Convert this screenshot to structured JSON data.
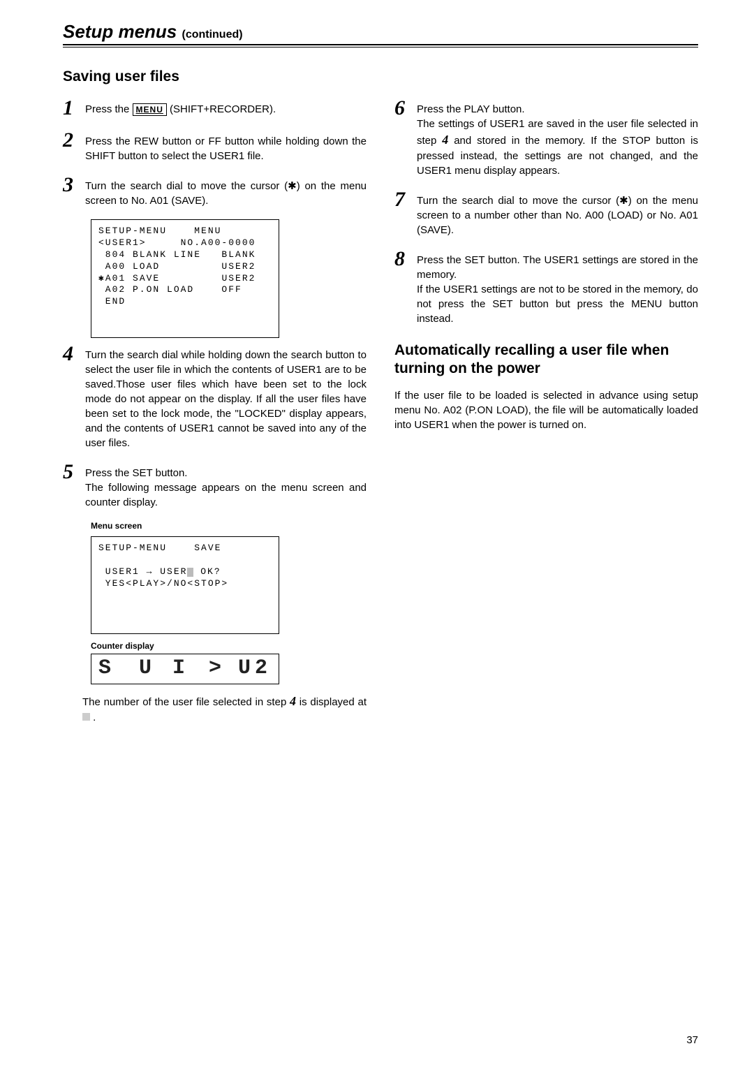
{
  "header": {
    "title": "Setup menus",
    "continued": "(continued)"
  },
  "section_title": "Saving user files",
  "steps_left": {
    "s1": {
      "num": "1",
      "pre": "Press the ",
      "menu_btn": "MENU",
      "post": " (SHIFT+RECORDER)."
    },
    "s2": {
      "num": "2",
      "text": "Press the REW button or FF button while holding down the SHIFT button to select the USER1 file."
    },
    "s3": {
      "num": "3",
      "text": "Turn the search dial to move the cursor (✱) on the menu screen to No. A01 (SAVE)."
    },
    "screen1": "SETUP-MENU    MENU\n<USER1>     NO.A00-0000\n 804 BLANK LINE   BLANK\n A00 LOAD         USER2\n✱A01 SAVE         USER2\n A02 P.ON LOAD    OFF\n END\n\n\n",
    "s4": {
      "num": "4",
      "text": "Turn the search dial while holding down the search button to select the user file in which the contents of USER1 are to be saved.Those user files which have been set to the lock mode do not appear on the display. If all the user files have been set to the lock mode, the \"LOCKED\" display appears, and the contents of USER1 cannot be saved into any of the user files."
    },
    "s5": {
      "num": "5",
      "lead": "Press the SET button.",
      "text": "The following message appears on the menu screen and counter display."
    },
    "menu_screen_label": "Menu screen",
    "screen2_l1": "SETUP-MENU    SAVE",
    "screen2_l2a": " USER1 ",
    "screen2_l2b": " USER",
    "screen2_l2c": " OK?",
    "screen2_l3": " YES<PLAY>/NO<STOP>",
    "counter_label": "Counter display",
    "after_counter_a": "The number of the user file selected in step ",
    "after_counter_b": " is displayed at ",
    "inline4": "4"
  },
  "steps_right": {
    "s6": {
      "num": "6",
      "lead": "Press the PLAY button.",
      "text_a": "The settings of USER1 are saved in the user file selected in step ",
      "inline4": "4",
      "text_b": " and stored in the memory. If the STOP button is pressed instead, the settings are not changed, and the USER1 menu display appears."
    },
    "s7": {
      "num": "7",
      "text": "Turn the search dial to move the cursor (✱) on the menu screen to a number other than No. A00 (LOAD) or No. A01 (SAVE)."
    },
    "s8": {
      "num": "8",
      "lead": "Press the SET button. The USER1 settings are stored in the memory.",
      "text": "If the USER1 settings are not to be stored in the memory, do not press the SET button but press the MENU button instead."
    },
    "subsection": "Automatically recalling a user file when turning on the power",
    "para": "If the user file to be loaded is selected in advance using setup menu No. A02 (P.ON LOAD), the file will be automatically loaded into USER1 when the power is turned on."
  },
  "page_number": "37",
  "counter_glyphs": {
    "a": "S",
    "b": "U I",
    "c": ">",
    "d": "U2"
  }
}
